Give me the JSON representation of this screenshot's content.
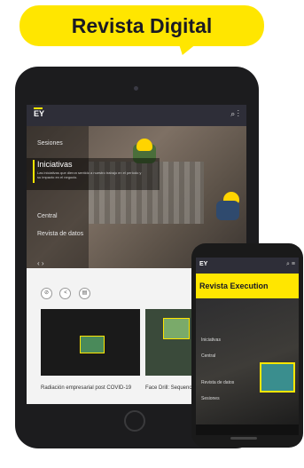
{
  "banner": {
    "title": "Revista Digital",
    "color": "#ffe600"
  },
  "tablet": {
    "logo": "EY",
    "header_icons": "⌕ ⋮",
    "menu_items": [
      "Sesiones",
      "Iniciativas",
      "Central",
      "Revista de datos"
    ],
    "active_item": {
      "title": "Iniciativas",
      "subtitle": "Las iniciativas que dieron sentido a nuestro trabajo en el periodo y su impacto en el negocio."
    },
    "hero_nav": "‹ ›",
    "share_icons": [
      "link-icon",
      "share-icon",
      "print-icon"
    ],
    "cards": [
      {
        "caption": "Radiación empresarial post COVID-19"
      },
      {
        "caption": "Face Drill: Sequencer"
      }
    ]
  },
  "phone": {
    "logo": "EY",
    "header_icons": "⌕ ≡",
    "yellow_title": "Revista Execution",
    "menu_items": [
      "Iniciativas",
      "Central",
      "Revista de datos",
      "Sesiones"
    ]
  }
}
